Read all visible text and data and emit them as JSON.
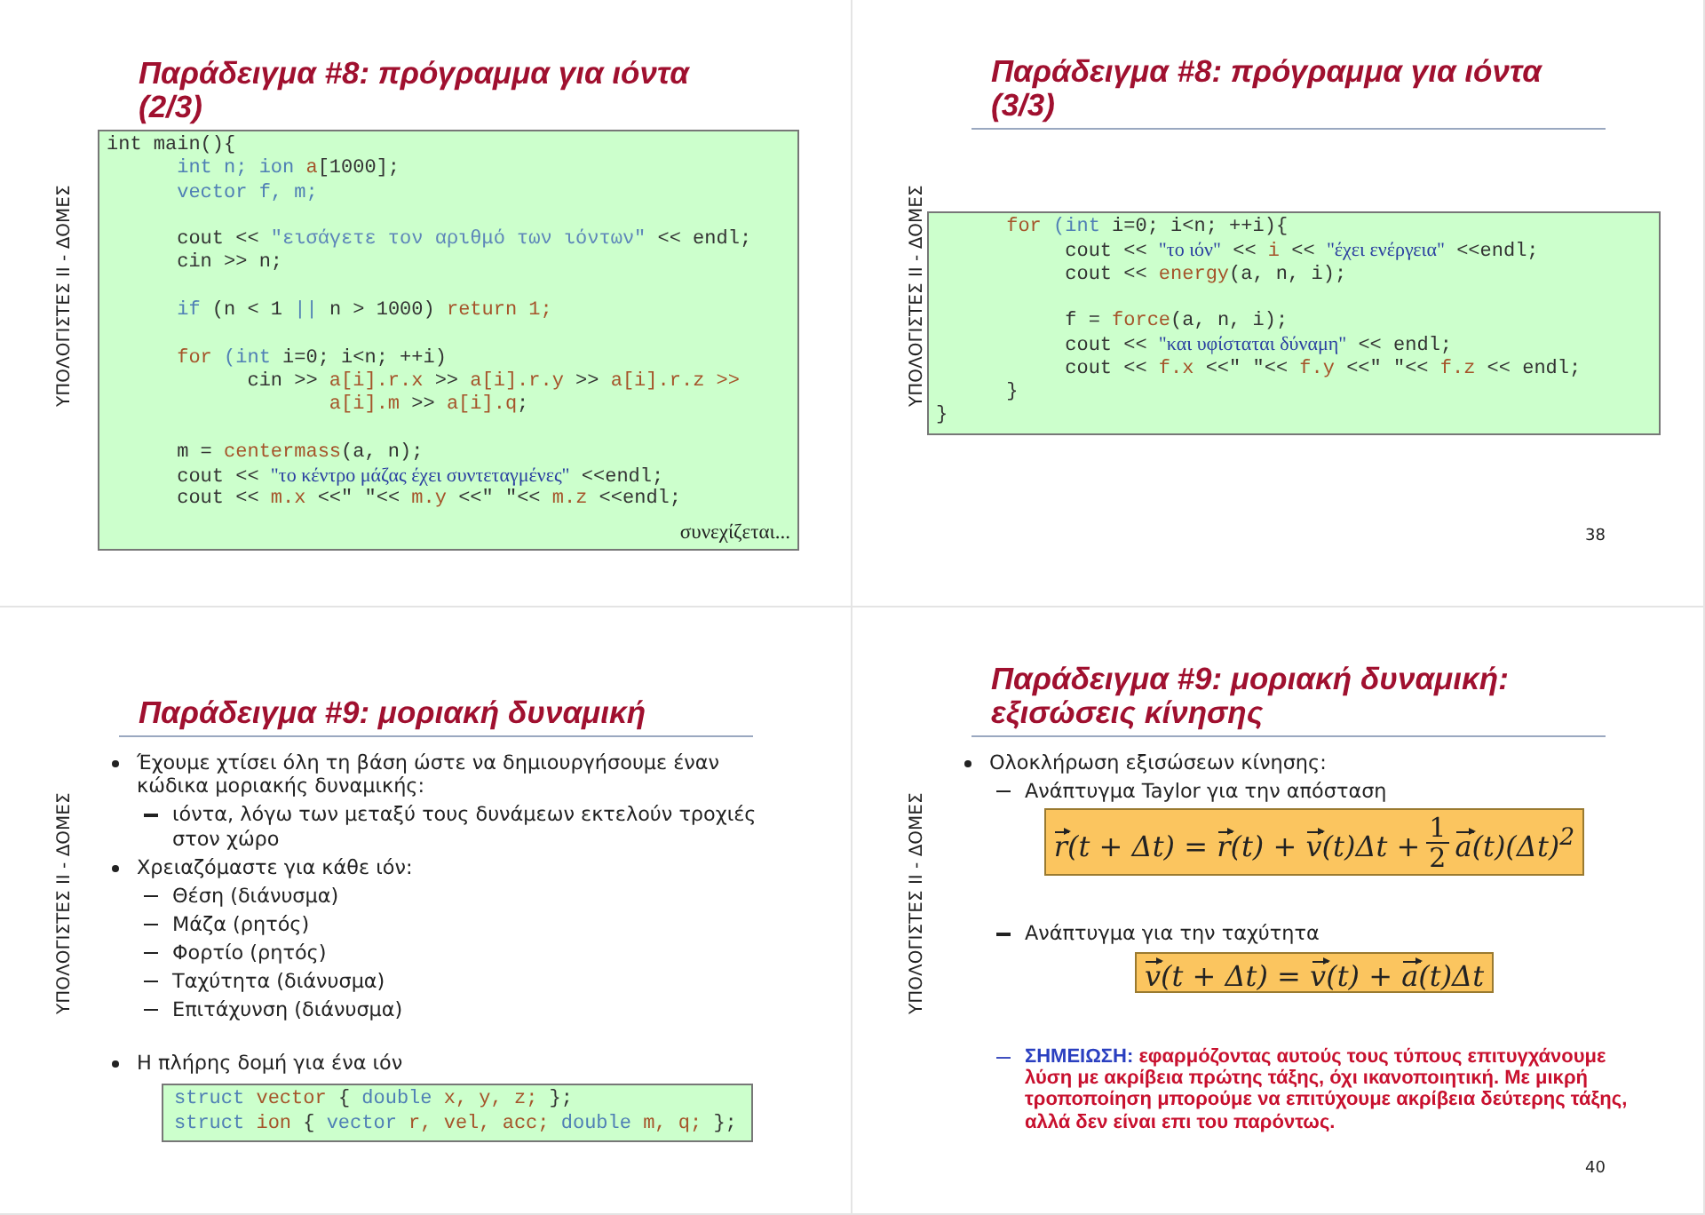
{
  "slides": [
    {
      "kind": "code",
      "sidebar": "ΥΠΟΛΟΓΙΣΤΕΣ II - ΔΟΜΕΣ",
      "title": "Παράδειγμα #8: πρόγραμμα για ιόντα (2/3)",
      "rule": false,
      "code": {
        "lines": [
          {
            "kind": "code",
            "segments": [
              {
                "kind": "txt",
                "text": "int main(){"
              }
            ]
          },
          {
            "kind": "code",
            "segments": [
              {
                "kind": "kw",
                "text": "      int n; ion "
              },
              {
                "kind": "fn",
                "text": "a"
              },
              {
                "kind": "txt",
                "text": "[1000];"
              }
            ]
          },
          {
            "kind": "code",
            "segments": [
              {
                "kind": "kw",
                "text": "      vector f, m;"
              }
            ]
          },
          {
            "kind": "blank"
          },
          {
            "kind": "code",
            "segments": [
              {
                "kind": "txt",
                "text": "      cout << "
              },
              {
                "kind": "str",
                "text": "\"εισάγετε τον αριθμό των ιόντων\""
              },
              {
                "kind": "txt",
                "text": " << endl;"
              }
            ]
          },
          {
            "kind": "code",
            "segments": [
              {
                "kind": "txt",
                "text": "      cin >> n;"
              }
            ]
          },
          {
            "kind": "blank"
          },
          {
            "kind": "code",
            "segments": [
              {
                "kind": "kw",
                "text": "      if "
              },
              {
                "kind": "txt",
                "text": "(n < 1 "
              },
              {
                "kind": "kw",
                "text": "||"
              },
              {
                "kind": "txt",
                "text": " n > 1000) "
              },
              {
                "kind": "fn",
                "text": "return 1;"
              }
            ]
          },
          {
            "kind": "blank"
          },
          {
            "kind": "code",
            "segments": [
              {
                "kind": "fn",
                "text": "      for "
              },
              {
                "kind": "kw",
                "text": "(int "
              },
              {
                "kind": "txt",
                "text": "i=0; i<n; ++i)"
              }
            ]
          },
          {
            "kind": "code",
            "segments": [
              {
                "kind": "txt",
                "text": "            cin >> "
              },
              {
                "kind": "fn",
                "text": "a[i].r.x"
              },
              {
                "kind": "txt",
                "text": " >> "
              },
              {
                "kind": "fn",
                "text": "a[i].r.y"
              },
              {
                "kind": "txt",
                "text": " >> "
              },
              {
                "kind": "fn",
                "text": "a[i].r.z >>"
              }
            ]
          },
          {
            "kind": "code",
            "segments": [
              {
                "kind": "fn",
                "text": "                   a[i].m"
              },
              {
                "kind": "txt",
                "text": " >> "
              },
              {
                "kind": "fn",
                "text": "a[i].q"
              },
              {
                "kind": "txt",
                "text": ";"
              }
            ]
          },
          {
            "kind": "blank"
          },
          {
            "kind": "code",
            "segments": [
              {
                "kind": "txt",
                "text": "      m = "
              },
              {
                "kind": "fn",
                "text": "centermass"
              },
              {
                "kind": "txt",
                "text": "(a, n);"
              }
            ]
          },
          {
            "kind": "code",
            "segments": [
              {
                "kind": "txt",
                "text": "      cout << "
              },
              {
                "kind": "greek",
                "text": "\"το κέντρο μάζας έχει συντεταγμένες\""
              },
              {
                "kind": "txt",
                "text": " <<endl;"
              }
            ]
          },
          {
            "kind": "code",
            "segments": [
              {
                "kind": "txt",
                "text": "      cout << "
              },
              {
                "kind": "fn",
                "text": "m.x"
              },
              {
                "kind": "txt",
                "text": " <<\" \"<< "
              },
              {
                "kind": "fn",
                "text": "m.y"
              },
              {
                "kind": "txt",
                "text": " <<\" \"<< "
              },
              {
                "kind": "fn",
                "text": "m.z"
              },
              {
                "kind": "txt",
                "text": " <<endl;"
              }
            ]
          }
        ],
        "continuation": "συνεχίζεται..."
      }
    },
    {
      "kind": "code",
      "sidebar": "ΥΠΟΛΟΓΙΣΤΕΣ II - ΔΟΜΕΣ",
      "title": "Παράδειγμα #8: πρόγραμμα για ιόντα (3/3)",
      "rule": true,
      "code": {
        "lines": [
          {
            "kind": "code",
            "segments": [
              {
                "kind": "fn",
                "text": "      for "
              },
              {
                "kind": "kw",
                "text": "(int "
              },
              {
                "kind": "txt",
                "text": "i=0; i<n; ++i){"
              }
            ]
          },
          {
            "kind": "code",
            "segments": [
              {
                "kind": "txt",
                "text": "           cout << "
              },
              {
                "kind": "greek",
                "text": "\"το ιόν\""
              },
              {
                "kind": "txt",
                "text": " << "
              },
              {
                "kind": "fn",
                "text": "i"
              },
              {
                "kind": "txt",
                "text": " << "
              },
              {
                "kind": "greek",
                "text": "\"έχει ενέργεια\""
              },
              {
                "kind": "txt",
                "text": " <<endl;"
              }
            ]
          },
          {
            "kind": "code",
            "segments": [
              {
                "kind": "txt",
                "text": "           cout << "
              },
              {
                "kind": "fn",
                "text": "energy"
              },
              {
                "kind": "txt",
                "text": "(a, n, i);"
              }
            ]
          },
          {
            "kind": "blank"
          },
          {
            "kind": "code",
            "segments": [
              {
                "kind": "txt",
                "text": "           f = "
              },
              {
                "kind": "fn",
                "text": "force"
              },
              {
                "kind": "txt",
                "text": "(a, n, i);"
              }
            ]
          },
          {
            "kind": "code",
            "segments": [
              {
                "kind": "txt",
                "text": "           cout << "
              },
              {
                "kind": "greek",
                "text": "\"και υφίσταται δύναμη\""
              },
              {
                "kind": "txt",
                "text": " << endl;"
              }
            ]
          },
          {
            "kind": "code",
            "segments": [
              {
                "kind": "txt",
                "text": "           cout << "
              },
              {
                "kind": "fn",
                "text": "f.x"
              },
              {
                "kind": "txt",
                "text": " <<\" \"<< "
              },
              {
                "kind": "fn",
                "text": "f.y"
              },
              {
                "kind": "txt",
                "text": " <<\" \"<< "
              },
              {
                "kind": "fn",
                "text": "f.z"
              },
              {
                "kind": "txt",
                "text": " << endl;"
              }
            ]
          },
          {
            "kind": "code",
            "segments": [
              {
                "kind": "txt",
                "text": "      }"
              }
            ]
          },
          {
            "kind": "code",
            "segments": [
              {
                "kind": "txt",
                "text": "}"
              }
            ]
          }
        ]
      },
      "page_number": "38"
    },
    {
      "kind": "bullets",
      "sidebar": "ΥΠΟΛΟΓΙΣΤΕΣ II - ΔΟΜΕΣ",
      "title": "Παράδειγμα #9: μοριακή δυναμική",
      "rule": true,
      "bullets": [
        {
          "text": "Έχουμε χτίσει όλη τη βάση ώστε να δημιουργήσουμε έναν κώδικα μοριακής δυναμικής:",
          "children": [
            {
              "text": "ιόντα, λόγω των μεταξύ τους δυνάμεων εκτελούν τροχιές στον χώρο"
            }
          ]
        },
        {
          "text": "Χρειαζόμαστε για κάθε ιόν:",
          "children": [
            {
              "text": "Θέση (διάνυσμα)"
            },
            {
              "text": "Μάζα (ρητός)"
            },
            {
              "text": "Φορτίο (ρητός)"
            },
            {
              "text": "Ταχύτητα (διάνυσμα)"
            },
            {
              "text": "Επιτάχυνση (διάνυσμα)"
            }
          ]
        },
        {
          "text": "Η πλήρης δομή για ένα ιόν",
          "code": {
            "lines": [
              {
                "kind": "code",
                "segments": [
                  {
                    "kind": "kw",
                    "text": "struct "
                  },
                  {
                    "kind": "fn",
                    "text": "vector "
                  },
                  {
                    "kind": "txt",
                    "text": "{ "
                  },
                  {
                    "kind": "kw",
                    "text": "double "
                  },
                  {
                    "kind": "fn",
                    "text": "x, y, z;"
                  },
                  {
                    "kind": "txt",
                    "text": " };"
                  }
                ]
              },
              {
                "kind": "code",
                "segments": [
                  {
                    "kind": "kw",
                    "text": "struct "
                  },
                  {
                    "kind": "fn",
                    "text": "ion "
                  },
                  {
                    "kind": "txt",
                    "text": "{ "
                  },
                  {
                    "kind": "kw",
                    "text": "vector "
                  },
                  {
                    "kind": "fn",
                    "text": "r, vel, acc;"
                  },
                  {
                    "kind": "kw",
                    "text": " double "
                  },
                  {
                    "kind": "fn",
                    "text": "m, q;"
                  },
                  {
                    "kind": "txt",
                    "text": " };"
                  }
                ]
              }
            ]
          }
        }
      ]
    },
    {
      "kind": "bullets",
      "sidebar": "ΥΠΟΛΟΓΙΣΤΕΣ II - ΔΟΜΕΣ",
      "title": "Παράδειγμα #9: μοριακή δυναμική: εξισώσεις κίνησης",
      "rule": true,
      "bullets": [
        {
          "text": "Ολοκλήρωση εξισώσεων κίνησης:",
          "children": [
            {
              "text": "Ανάπτυγμα Taylor για την απόσταση",
              "formula": {
                "kind": "fraction",
                "before": [
                  {
                    "text": "r",
                    "vector": true
                  },
                  {
                    "text": "(t + Δt) = ",
                    "vector": false
                  },
                  {
                    "text": "r",
                    "vector": true
                  },
                  {
                    "text": "(t) + ",
                    "vector": false
                  },
                  {
                    "text": "v",
                    "vector": true
                  },
                  {
                    "text": "(t)Δt +",
                    "vector": false
                  }
                ],
                "numerator": "1",
                "denominator": "2",
                "after": [
                  {
                    "text": "a",
                    "vector": true
                  },
                  {
                    "text": "(t)(Δt)$^{2}$",
                    "vector": false
                  }
                ]
              }
            },
            {
              "text": "Ανάπτυγμα για την ταχύτητα",
              "formula": {
                "kind": "plain",
                "before": [
                  {
                    "text": "v",
                    "vector": true
                  },
                  {
                    "text": "(t + Δt) = ",
                    "vector": false
                  },
                  {
                    "text": "v",
                    "vector": true
                  },
                  {
                    "text": "(t) + ",
                    "vector": false
                  },
                  {
                    "text": "a",
                    "vector": true
                  },
                  {
                    "text": "(t)Δt",
                    "vector": false
                  }
                ]
              }
            }
          ]
        }
      ],
      "note": {
        "label": "ΣΗΜΕΙΩΣΗ:",
        "text": "εφαρμόζοντας αυτούς τους τύπους επιτυγχάνουμε λύση με ακρίβεια πρώτης τάξης, όχι ικανοποιητική. Με μικρή τροποποίηση μπορούμε να επιτύχουμε ακρίβεια δεύτερης τάξης, αλλά δεν είναι επι του παρόντως."
      },
      "page_number": "40"
    }
  ]
}
